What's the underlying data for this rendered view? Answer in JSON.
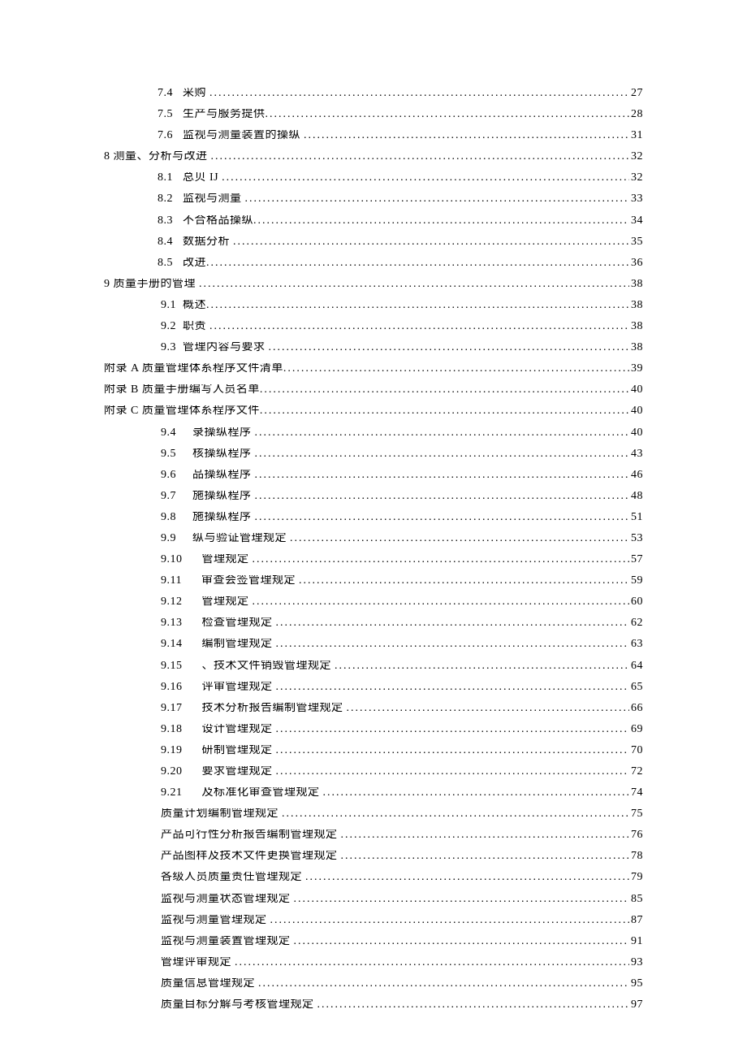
{
  "toc": [
    {
      "indent": 1,
      "num": "7.4   ",
      "title": "采购 ",
      "page": "27"
    },
    {
      "indent": 1,
      "num": "7.5   ",
      "title": "生产与服务提供",
      "page": "28"
    },
    {
      "indent": 1,
      "num": "7.6   ",
      "title": "监视与测量装置的操纵 ",
      "page": "31"
    },
    {
      "indent": 0,
      "num": "",
      "title": "8 测量、分析与改进 ",
      "page": "32"
    },
    {
      "indent": 1,
      "num": "8.1   ",
      "title": "总贝 IJ ",
      "page": "32"
    },
    {
      "indent": 1,
      "num": "8.2   ",
      "title": "监视与测量 ",
      "page": "33"
    },
    {
      "indent": 1,
      "num": "8.3   ",
      "title": "不合格品操纵",
      "page": "34"
    },
    {
      "indent": 1,
      "num": "8.4   ",
      "title": "数据分析 ",
      "page": "35"
    },
    {
      "indent": 1,
      "num": "8.5   ",
      "title": "改进",
      "page": "36"
    },
    {
      "indent": 0,
      "num": "",
      "title": "9 质量手册的管理 ",
      "page": "38"
    },
    {
      "indent": 2,
      "num": "9.1  ",
      "title": "概述",
      "page": "38"
    },
    {
      "indent": 2,
      "num": "9.2  ",
      "title": "职责 ",
      "page": "38"
    },
    {
      "indent": 2,
      "num": "9.3  ",
      "title": "管理内容与要求 ",
      "page": "38"
    },
    {
      "indent": 0,
      "num": "",
      "title": "附录 A 质量管理体系程序文件清单",
      "page": "39"
    },
    {
      "indent": 0,
      "num": "",
      "title": "附录 B 质量手册编写人员名单",
      "page": "40"
    },
    {
      "indent": 0,
      "num": "",
      "title": "附录 C 质量管理体系程序文件",
      "page": "40"
    },
    {
      "indent": 2,
      "num": "9.4     ",
      "title": "录操纵程序 ",
      "page": "40"
    },
    {
      "indent": 2,
      "num": "9.5     ",
      "title": "核操纵程序 ",
      "page": "43"
    },
    {
      "indent": 2,
      "num": "9.6     ",
      "title": "品操纵程序 ",
      "page": "46"
    },
    {
      "indent": 2,
      "num": "9.7     ",
      "title": "施操纵程序 ",
      "page": "48"
    },
    {
      "indent": 2,
      "num": "9.8     ",
      "title": "施操纵程序 ",
      "page": "51"
    },
    {
      "indent": 2,
      "num": "9.9     ",
      "title": "纵与验证管理规定 ",
      "page": "53"
    },
    {
      "indent": 2,
      "num": "9.10      ",
      "title": "管理规定 ",
      "page": "57"
    },
    {
      "indent": 2,
      "num": "9.11      ",
      "title": "审查会签管理规定 ",
      "page": "59"
    },
    {
      "indent": 2,
      "num": "9.12      ",
      "title": "管理规定 ",
      "page": "60"
    },
    {
      "indent": 2,
      "num": "9.13      ",
      "title": "检查管理规定 ",
      "page": "62"
    },
    {
      "indent": 2,
      "num": "9.14      ",
      "title": "编制管理规定 ",
      "page": "63"
    },
    {
      "indent": 2,
      "num": "9.15      ",
      "title": "、技术文件销毁管理规定 ",
      "page": "64"
    },
    {
      "indent": 2,
      "num": "9.16      ",
      "title": "评审管理规定 ",
      "page": "65"
    },
    {
      "indent": 2,
      "num": "9.17      ",
      "title": "技术分析报告编制管理规定 ",
      "page": "66"
    },
    {
      "indent": 2,
      "num": "9.18      ",
      "title": "设计管理规定 ",
      "page": "69"
    },
    {
      "indent": 2,
      "num": "9.19      ",
      "title": "研制管理规定 ",
      "page": "70"
    },
    {
      "indent": 2,
      "num": "9.20      ",
      "title": "要求管理规定 ",
      "page": "72"
    },
    {
      "indent": 2,
      "num": "9.21      ",
      "title": "及标准化审查管理规定 ",
      "page": "74"
    },
    {
      "indent": 3,
      "num": "",
      "title": "质量计划编制管理规定 ",
      "page": "75"
    },
    {
      "indent": 3,
      "num": "",
      "title": "产品可行性分析报告编制管理规定 ",
      "page": "76"
    },
    {
      "indent": 3,
      "num": "",
      "title": "产品图样及技术文件更换管理规定 ",
      "page": "78"
    },
    {
      "indent": 3,
      "num": "",
      "title": "各级人员质量责任管理规定 ",
      "page": "79"
    },
    {
      "indent": 3,
      "num": "",
      "title": "监视与测量状态管理规定 ",
      "page": "85"
    },
    {
      "indent": 3,
      "num": "",
      "title": "监视与测量管理规定 ",
      "page": "87"
    },
    {
      "indent": 3,
      "num": "",
      "title": "监视与测量装置管理规定 ",
      "page": "91"
    },
    {
      "indent": 3,
      "num": "",
      "title": "管理评审规定 ",
      "page": "93"
    },
    {
      "indent": 3,
      "num": "",
      "title": "质量信息管理规定 ",
      "page": "95"
    },
    {
      "indent": 3,
      "num": "",
      "title": "质量目标分解与考核管理规定 ",
      "page": "97"
    }
  ]
}
